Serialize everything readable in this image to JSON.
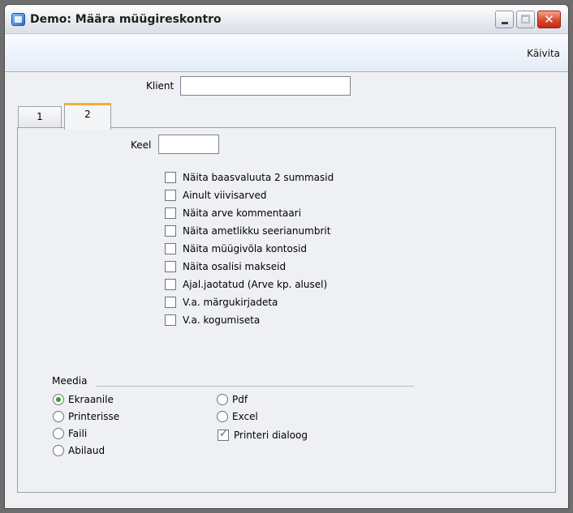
{
  "window": {
    "title": "Demo: Määra müügireskontro"
  },
  "toolbar": {
    "run_label": "Käivita"
  },
  "client": {
    "label": "Klient",
    "value": ""
  },
  "tabs": [
    {
      "label": "1"
    },
    {
      "label": "2"
    }
  ],
  "language": {
    "label": "Keel",
    "value": ""
  },
  "options": [
    {
      "label": "Näita baasvaluuta 2 summasid",
      "checked": false
    },
    {
      "label": "Ainult viivisarved",
      "checked": false
    },
    {
      "label": "Näita arve kommentaari",
      "checked": false
    },
    {
      "label": "Näita ametlikku seerianumbrit",
      "checked": false
    },
    {
      "label": "Näita müügivõla kontosid",
      "checked": false
    },
    {
      "label": "Näita osalisi makseid",
      "checked": false
    },
    {
      "label": "Ajal.jaotatud (Arve kp. alusel)",
      "checked": false
    },
    {
      "label": "V.a. märgukirjadeta",
      "checked": false
    },
    {
      "label": "V.a. kogumiseta",
      "checked": false
    }
  ],
  "media": {
    "label": "Meedia",
    "left": [
      {
        "label": "Ekraanile",
        "selected": true
      },
      {
        "label": "Printerisse",
        "selected": false
      },
      {
        "label": "Faili",
        "selected": false
      },
      {
        "label": "Abilaud",
        "selected": false
      }
    ],
    "right": [
      {
        "label": "Pdf",
        "selected": false
      },
      {
        "label": "Excel",
        "selected": false
      }
    ],
    "printer_dialog": {
      "label": "Printeri dialoog",
      "checked": true
    }
  }
}
